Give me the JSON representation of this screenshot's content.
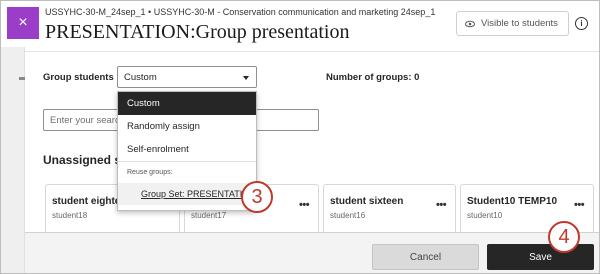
{
  "header": {
    "breadcrumb": "USSYHC-30-M_24sep_1 • USSYHC-30-M - Conservation communication and marketing 24sep_1",
    "title": "PRESENTATION:Group presentation",
    "visibility_label": "Visible to students",
    "close_icon": "×"
  },
  "form": {
    "group_students_label": "Group students",
    "group_students_value": "Custom",
    "number_of_groups_label": "Number of groups: 0",
    "search_placeholder": "Enter your search"
  },
  "dropdown": {
    "options": [
      "Custom",
      "Randomly assign",
      "Self-enrolment"
    ],
    "selected": "Custom",
    "reuse_label": "Reuse groups:",
    "group_set": "Group Set: PRESENTATI"
  },
  "unassigned": {
    "title": "Unassigned students",
    "students": [
      {
        "name": "student eighteen",
        "username": "student18"
      },
      {
        "name": "",
        "username": "student17"
      },
      {
        "name": "student sixteen",
        "username": "student16"
      },
      {
        "name": "Student10 TEMP10",
        "username": "student10"
      }
    ]
  },
  "footer": {
    "cancel_label": "Cancel",
    "save_label": "Save"
  },
  "annotations": {
    "step_3": "3",
    "step_4": "4"
  },
  "colors": {
    "accent": "#9a3ec8",
    "primary_button": "#262626",
    "annotation": "#c0392b"
  }
}
